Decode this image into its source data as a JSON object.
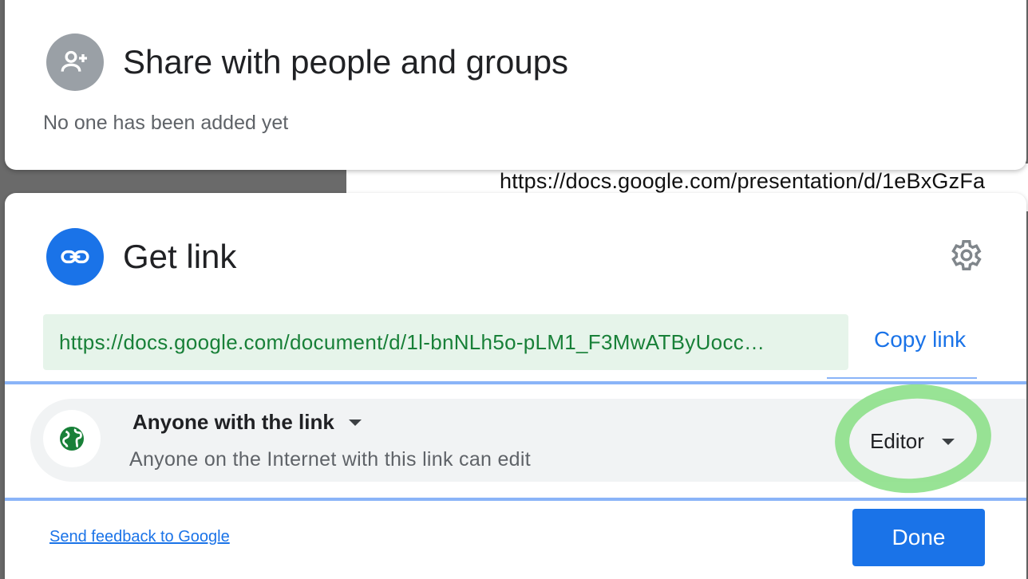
{
  "background": {
    "url_text": "https://docs.google.com/presentation/d/1eBxGzFa"
  },
  "share": {
    "title": "Share with people and groups",
    "empty_text": "No one has been added yet",
    "icon": "person-add-icon"
  },
  "get_link": {
    "title": "Get link",
    "icon": "link-icon",
    "settings_icon": "gear-icon",
    "url": "https://docs.google.com/document/d/1l-bnNLh5o-pLM1_F3MwATByUocc…",
    "copy_label": "Copy link",
    "access": {
      "title": "Anyone with the link",
      "description": "Anyone on the Internet with this link can edit",
      "icon": "globe-icon",
      "role": "Editor"
    },
    "feedback_label": "Send feedback to Google",
    "done_label": "Done"
  },
  "colors": {
    "accent": "#1a73e8",
    "link_green": "#188038",
    "link_bg": "#e6f4ea",
    "highlight": "#8de08a"
  }
}
